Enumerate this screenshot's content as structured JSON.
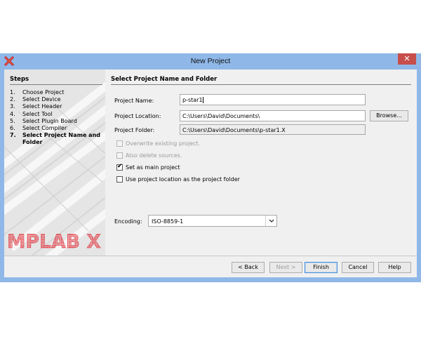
{
  "window": {
    "title": "New Project",
    "close_glyph": "✕",
    "app_icon": "x-app-icon"
  },
  "steps": {
    "heading": "Steps",
    "items": [
      {
        "num": "1.",
        "label": "Choose Project"
      },
      {
        "num": "2.",
        "label": "Select Device"
      },
      {
        "num": "3.",
        "label": "Select Header"
      },
      {
        "num": "4.",
        "label": "Select Tool"
      },
      {
        "num": "5.",
        "label": "Select Plugin Board"
      },
      {
        "num": "6.",
        "label": "Select Compiler"
      },
      {
        "num": "7.",
        "label": "Select Project Name and Folder",
        "current": true
      }
    ],
    "logo_text": "MPLAB X"
  },
  "main": {
    "heading": "Select Project Name and Folder",
    "project_name_label": "Project Name:",
    "project_name_value": "p-star1",
    "project_location_label": "Project Location:",
    "project_location_value": "C:\\Users\\David\\Documents\\",
    "browse_label": "Browse...",
    "project_folder_label": "Project Folder:",
    "project_folder_value": "C:\\Users\\David\\Documents\\p-star1.X",
    "options": [
      {
        "label": "Overwrite existing project.",
        "checked": false,
        "enabled": false
      },
      {
        "label": "Also delete sources.",
        "checked": false,
        "enabled": false
      },
      {
        "label": "Set as main project",
        "checked": true,
        "enabled": true
      },
      {
        "label": "Use project location as the project folder",
        "checked": false,
        "enabled": true
      }
    ],
    "encoding_label": "Encoding:",
    "encoding_value": "ISO-8859-1"
  },
  "footer": {
    "back_label": "< Back",
    "next_label": "Next >",
    "finish_label": "Finish",
    "cancel_label": "Cancel",
    "help_label": "Help"
  },
  "colors": {
    "title_bar": "#8fb8e8",
    "close_button": "#c74f4b",
    "logo_red": "#e0303a"
  }
}
